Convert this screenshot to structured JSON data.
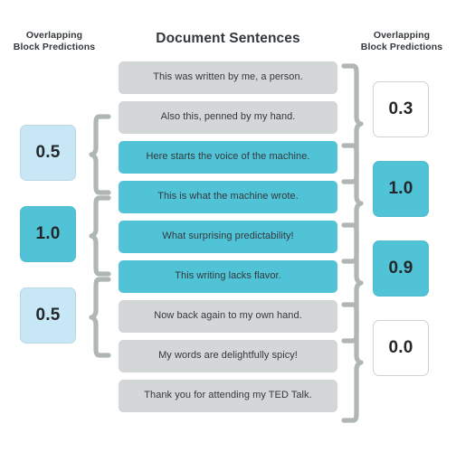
{
  "headers": {
    "left": "Overlapping\nBlock Predictions",
    "left_line1": "Overlapping",
    "left_line2": "Block Predictions",
    "center": "Document Sentences",
    "right_line1": "Overlapping",
    "right_line2": "Block Predictions"
  },
  "colors": {
    "human_block": "#d4d7d7",
    "machine_block": "#51c3d6",
    "light_prediction": "#c8e7f6",
    "teal_prediction": "#51c3d6",
    "white_prediction": "#ffffff",
    "brace": "#b0b5b5",
    "text": "#33383d",
    "background": "#ffffff"
  },
  "sentences": [
    {
      "text": "This was written by me, a person.",
      "type": "human"
    },
    {
      "text": "Also this, penned by my hand.",
      "type": "human"
    },
    {
      "text": "Here starts the voice of the machine.",
      "type": "machine"
    },
    {
      "text": "This is what the machine wrote.",
      "type": "machine"
    },
    {
      "text": "What surprising predictability!",
      "type": "machine"
    },
    {
      "text": "This writing lacks flavor.",
      "type": "machine"
    },
    {
      "text": "Now back again to my own hand.",
      "type": "human"
    },
    {
      "text": "My words are delightfully spicy!",
      "type": "human"
    },
    {
      "text": "Thank you for attending my TED Talk.",
      "type": "human"
    }
  ],
  "left_predictions": [
    {
      "value": "0.5",
      "fill": "light",
      "spans": [
        2,
        3
      ]
    },
    {
      "value": "1.0",
      "fill": "teal",
      "spans": [
        4,
        5
      ]
    },
    {
      "value": "0.5",
      "fill": "light",
      "spans": [
        6,
        7
      ]
    }
  ],
  "right_predictions": [
    {
      "value": "0.3",
      "fill": "white",
      "spans": [
        1,
        3
      ]
    },
    {
      "value": "1.0",
      "fill": "teal",
      "spans": [
        3,
        5
      ]
    },
    {
      "value": "0.9",
      "fill": "teal",
      "spans": [
        5,
        7
      ]
    },
    {
      "value": "0.0",
      "fill": "white",
      "spans": [
        7,
        9
      ]
    }
  ]
}
